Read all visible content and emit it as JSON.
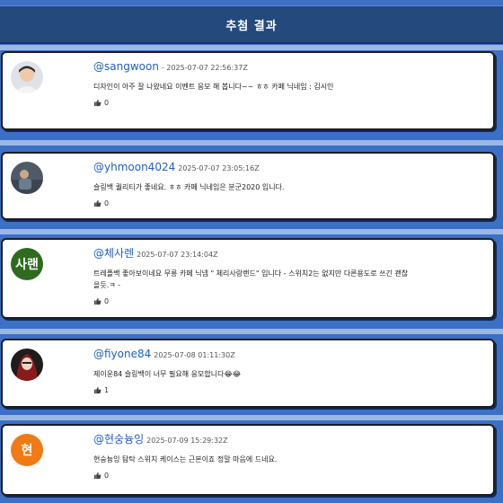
{
  "header": {
    "title": "추첨 결과"
  },
  "comments": [
    {
      "username": "@sangwoon",
      "timestamp": "- 2025-07-07 22:56:37Z",
      "text": "디자인이 아주 잘 나왔네요 이벤트 응모 해 봅니다~~ ㅎㅎ 카페 닉네임 : 김시인",
      "likes": "0",
      "avatar": {
        "type": "photo-icon"
      }
    },
    {
      "username": "@yhmoon4024",
      "timestamp": "2025-07-07 23:05:16Z",
      "text": "슬링백 퀄리티가 좋네요. ㅎㅎ 카페 닉네임은 분군2020 입니다.",
      "likes": "0",
      "avatar": {
        "type": "photo-icon"
      }
    },
    {
      "username": "@체사렌",
      "timestamp": "2025-07-07 23:14:04Z",
      "text": "트레플백 좋아보이네요 무릉 카페 닉넴 \" 체리사랑랜드\" 입니다 - 스위치2는 없지만 다른용도로 쓰긴 괜찮을듯.ㅋ -",
      "likes": "0",
      "avatar": {
        "type": "initial",
        "initial": "사랜",
        "color": "#2e6b1f"
      }
    },
    {
      "username": "@fiyone84",
      "timestamp": "2025-07-08 01:11:30Z",
      "text": "제이운84 슬링백이 너무 필요해 응모합니다😂😂",
      "likes": "1",
      "avatar": {
        "type": "photo-icon"
      }
    },
    {
      "username": "@현숭늉잉",
      "timestamp": "2025-07-09 15:29:32Z",
      "text": "현숭늉잉 탐탁 스위치 케이스는 근본이죠 정말 마음에 드네요.",
      "likes": "0",
      "avatar": {
        "type": "initial",
        "initial": "현",
        "color": "#f07a14"
      }
    }
  ]
}
